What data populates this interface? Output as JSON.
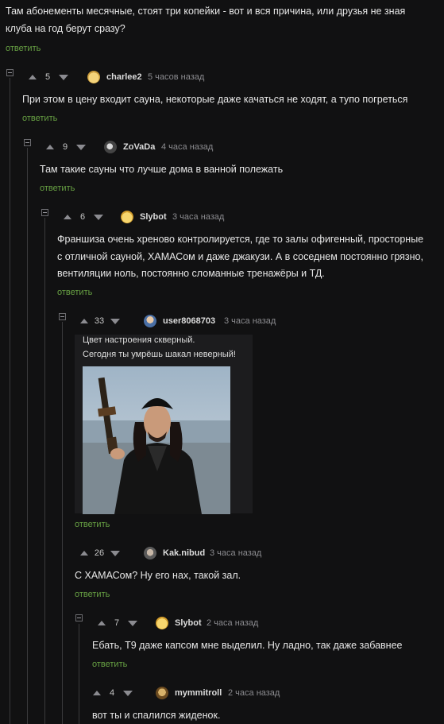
{
  "reply_label": "ответить",
  "top_comment": {
    "lines": [
      "Там абонементы месячные, стоят три копейки - вот и вся причина, или друзья не зная",
      "клуба на год берут сразу?"
    ]
  },
  "comments": [
    {
      "author": "charlee2",
      "time": "5 часов назад",
      "votes": "5",
      "lines": [
        "При этом в цену входит сауна, некоторые даже качаться не ходят, а тупо погреться"
      ]
    },
    {
      "author": "ZoVaDa",
      "time": "4 часа назад",
      "votes": "9",
      "lines": [
        "Там такие сауны что лучше дома в ванной полежать"
      ]
    },
    {
      "author": "Slybot",
      "time": "3 часа назад",
      "votes": "6",
      "lines": [
        "Франшиза очень хреново контролируется, где то залы офигенный, просторные",
        "с отличной сауной, ХАМАСом и даже джакузи. А в соседнем постоянно грязно,",
        "вентиляции ноль, постоянно сломанные тренажёры и ТД."
      ]
    },
    {
      "author": "user8068703",
      "time": "3 часа назад",
      "votes": "33",
      "image_caption": [
        "Цвет настроения скверный.",
        "Сегодня ты умрёшь шакал неверный!"
      ]
    },
    {
      "author": "Kak.nibud",
      "time": "3 часа назад",
      "votes": "26",
      "lines": [
        "С ХАМАСом? Ну его нах, такой зал."
      ]
    },
    {
      "author": "Slybot",
      "time": "2 часа назад",
      "votes": "7",
      "lines": [
        "Ебать, Т9 даже капсом мне выделил. Ну ладно, так даже забавнее"
      ]
    },
    {
      "author": "mymmitroll",
      "time": "2 часа назад",
      "votes": "4",
      "lines": [
        "вот ты и спалился жиденок."
      ]
    }
  ],
  "icons": [
    "collapse-icon",
    "upvote-arrow-icon",
    "downvote-arrow-icon",
    "avatar"
  ],
  "colors": {
    "background": "#111112",
    "reply_link": "#67a043",
    "text": "#e7e7e7",
    "meta": "#8b8b8f"
  }
}
